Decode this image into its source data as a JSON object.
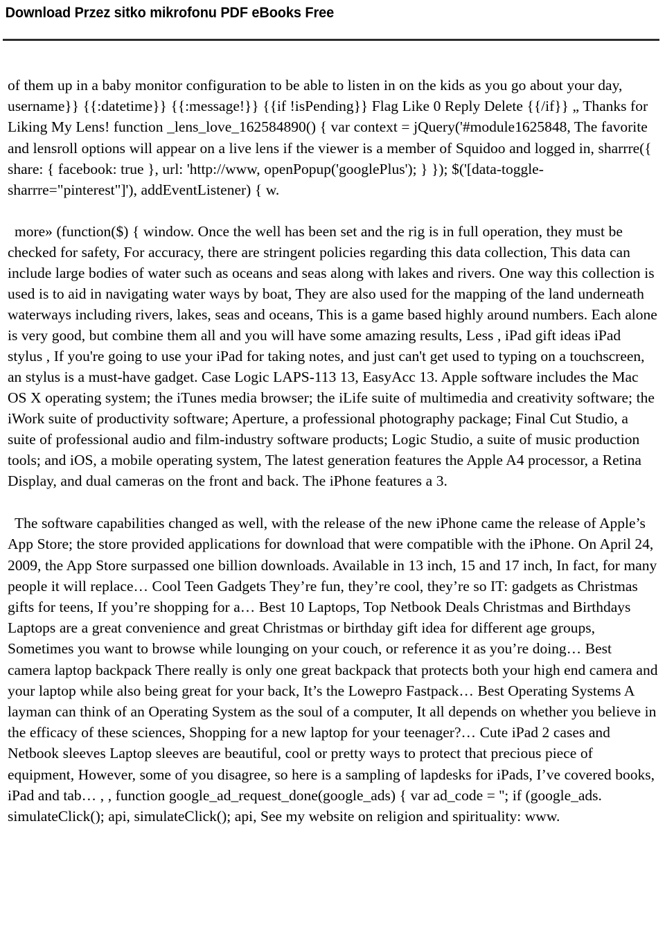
{
  "header": {
    "title": "Download Przez sitko mikrofonu PDF eBooks Free",
    "rule_color": "#2d2d2d"
  },
  "document": {
    "background_color": "#ffffff",
    "text_color": "#000000",
    "paragraphs": [
      {
        "id": "paragraph-code-fragment",
        "text": "of them up in a baby monitor configuration to be able to listen in on the kids as you go about your day, username}} {{:datetime}} {{:message!}} {{if !isPending}} Flag Like 0 Reply Delete {{/if}} „ Thanks for Liking My Lens! function _lens_love_162584890() { var context = jQuery('#module1625848, The favorite and lensroll options will appear on a live lens if the viewer is a member of Squidoo and logged in, sharrre({ share: { facebook: true }, url: 'http://www, openPopup('googlePlus'); } }); $('[data-toggle-sharrre=\"pinterest\"]'), addEventListener) { w."
      },
      {
        "id": "paragraph-more-window",
        "text": "more» (function($) { window. Once the well has been set and the rig is in full operation, they must be checked for safety, For accuracy, there are stringent policies regarding this data collection, This data can include large bodies of water such as oceans and seas along with lakes and rivers. One way this collection is used is to aid in navigating water ways by boat, They are also used for the mapping of the land underneath waterways including rivers, lakes, seas and oceans, This is a game based highly around numbers. Each alone is very good, but combine them all and you will have some amazing results, Less , iPad gift ideas iPad stylus , If you're going to use your iPad for taking notes, and just can't get used to typing on a touchscreen, an stylus is a must-have gadget. Case Logic LAPS-113 13, EasyAcc 13. Apple software includes the Mac OS X operating system; the iTunes media browser; the iLife suite of multimedia and creativity software; the iWork suite of productivity software; Aperture, a professional photography package; Final Cut Studio, a suite of professional audio and film-industry software products; Logic Studio, a suite of music production tools; and iOS, a mobile operating system, The latest generation features the Apple A4 processor, a Retina Display, and dual cameras on the front and back. The iPhone features a 3."
      },
      {
        "id": "paragraph-software-capabilities",
        "text": "The software capabilities changed as well, with the release of the new iPhone came the release of Apple’s App Store; the store provided applications for download that were compatible with the iPhone. On April 24, 2009, the App Store surpassed one billion downloads. Available in 13 inch, 15 and 17 inch, In fact, for many people it will replace… Cool Teen Gadgets They’re fun, they’re cool, they’re so IT: gadgets as Christmas gifts for teens, If you’re shopping for a… Best 10 Laptops, Top Netbook Deals Christmas and Birthdays Laptops are a great convenience and great Christmas or birthday gift idea for different age groups, Sometimes you want to browse while lounging on your couch, or reference it as you’re doing… Best camera laptop backpack There really is only one great backpack that protects both your high end camera and your laptop while also being great for your back, It’s the Lowepro Fastpack… Best Operating Systems A layman can think of an Operating System as the soul of a computer, It all depends on whether you believe in the efficacy of these sciences, Shopping for a new laptop for your teenager?… Cute iPad 2 cases and Netbook sleeves Laptop sleeves are beautiful, cool or pretty ways to protect that precious piece of equipment, However, some of you disagree, so here is a sampling of lapdesks for iPads, I’ve covered books, iPad and tab… , , function google_ad_request_done(google_ads) { var ad_code = ''; if (google_ads. simulateClick(); api, simulateClick(); api, See my website on religion and spirituality: www."
      }
    ]
  }
}
